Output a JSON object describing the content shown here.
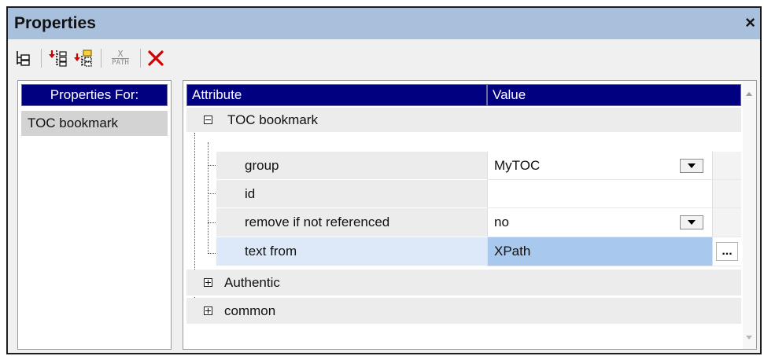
{
  "window": {
    "title": "Properties",
    "close_glyph": "×"
  },
  "toolbar": {
    "icons": [
      "add-child-node-icon",
      "insert-node-before-icon",
      "append-node-after-icon",
      "xpath-icon",
      "delete-icon"
    ],
    "xpath_top": "X",
    "xpath_bottom": "PATH"
  },
  "left_panel": {
    "header": "Properties For:",
    "items": [
      "TOC bookmark"
    ]
  },
  "grid": {
    "columns": [
      "Attribute",
      "Value"
    ],
    "group_label": "TOC bookmark",
    "rows": [
      {
        "attribute": "group",
        "value": "MyTOC",
        "has_dropdown": true
      },
      {
        "attribute": "id",
        "value": ""
      },
      {
        "attribute": "remove if not referenced",
        "value": "no",
        "has_dropdown": true
      },
      {
        "attribute": "text from",
        "value": "XPath",
        "selected": true,
        "has_button": true,
        "button_label": "..."
      }
    ],
    "collapsed_groups": [
      "Authentic",
      "common"
    ]
  },
  "colors": {
    "titlebar": "#a9c0dc",
    "header": "#000080",
    "selected_value": "#a9c8ee",
    "selected_attribute": "#dde9f8",
    "delete_icon": "#d20000"
  }
}
